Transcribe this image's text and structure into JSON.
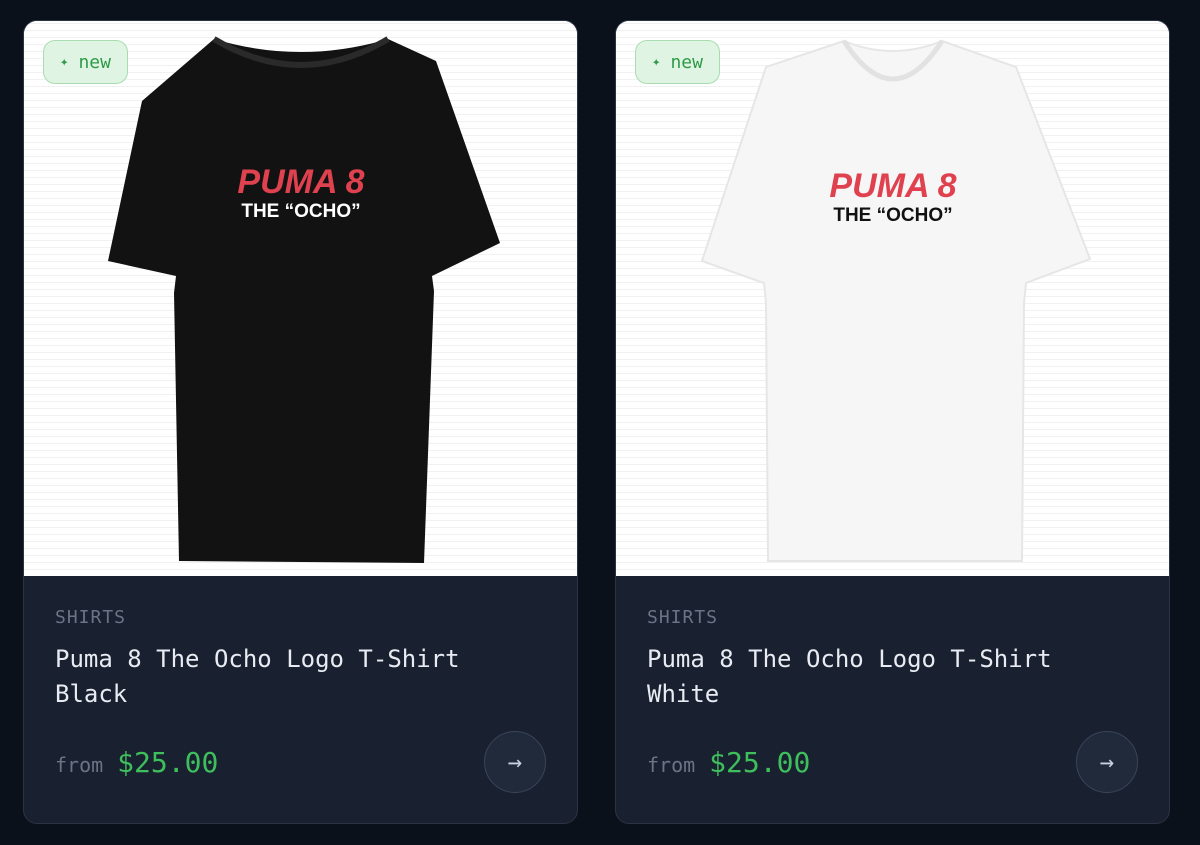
{
  "products": [
    {
      "badge": "new",
      "badge_icon": "sparkle-icon",
      "category": "SHIRTS",
      "title": "Puma 8 The Ocho Logo T-Shirt Black",
      "from_label": "from",
      "price": "$25.00",
      "shirt_color": "#121212",
      "print_top": "PUMA 8",
      "print_bottom": "THE “OCHO”",
      "print_bottom_color": "#ffffff",
      "arrow": "→"
    },
    {
      "badge": "new",
      "badge_icon": "sparkle-icon",
      "category": "SHIRTS",
      "title": "Puma 8 The Ocho Logo T-Shirt White",
      "from_label": "from",
      "price": "$25.00",
      "shirt_color": "#f6f6f6",
      "print_top": "PUMA 8",
      "print_bottom": "THE “OCHO”",
      "print_bottom_color": "#111111",
      "arrow": "→"
    }
  ],
  "colors": {
    "accent_green": "#3fbf5c",
    "print_red": "#e0414f",
    "card_bg": "#192030",
    "page_bg": "#0b111a"
  }
}
